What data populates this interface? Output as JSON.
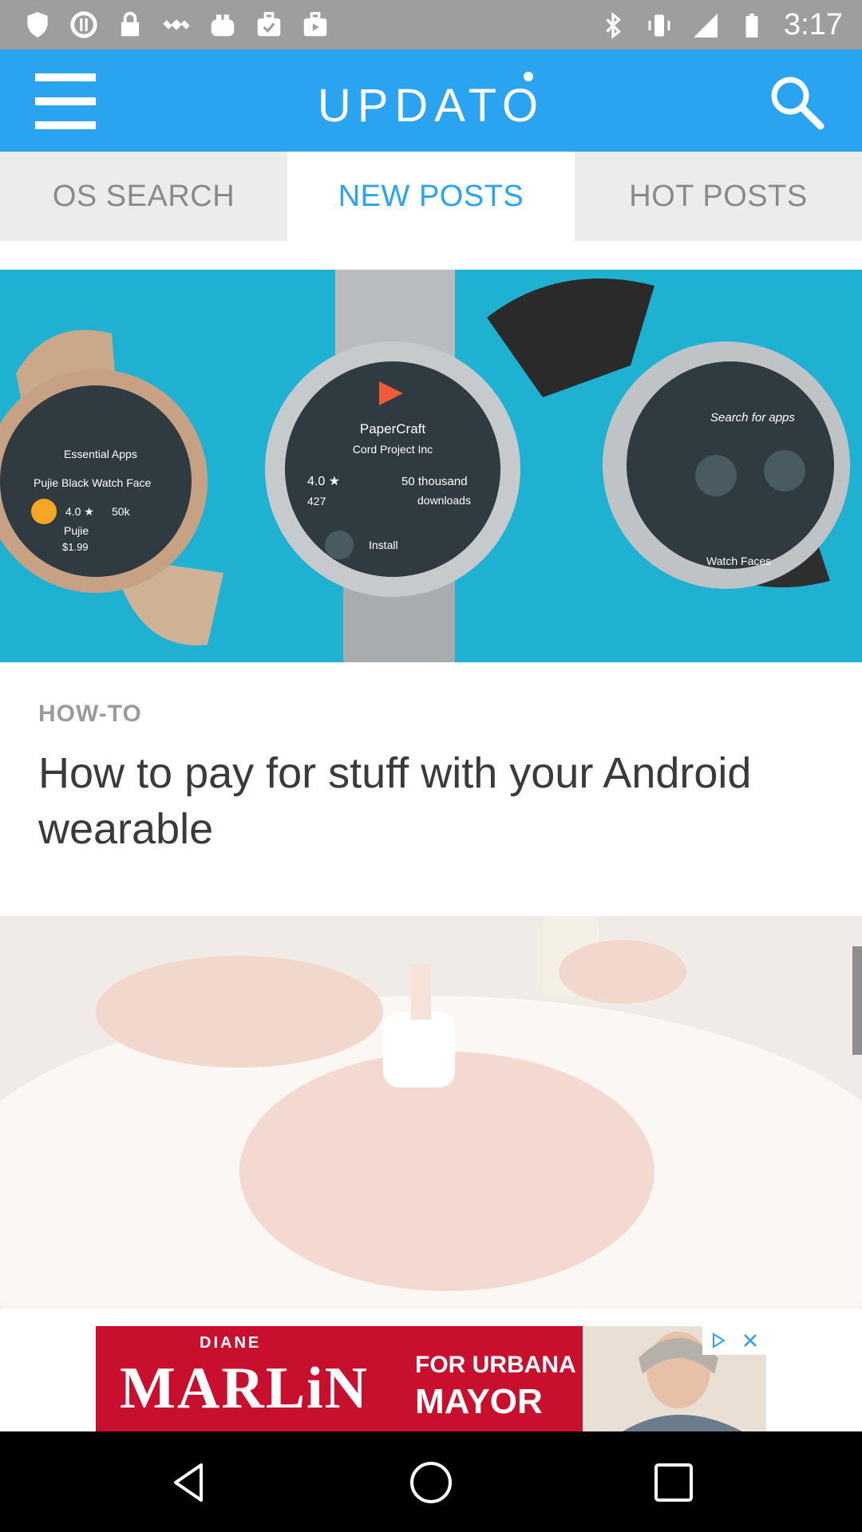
{
  "status_bar": {
    "time": "3:17",
    "left_icons": [
      "shield-icon",
      "sync-icon",
      "lock-icon",
      "satellite-icon",
      "toaster-icon",
      "briefcase-check-icon",
      "briefcase-play-icon"
    ],
    "right_icons": [
      "bluetooth-icon",
      "vibrate-icon",
      "signal-icon",
      "battery-icon"
    ]
  },
  "app_bar": {
    "logo_text": "UPDATO",
    "menu_icon": "hamburger-menu-icon",
    "search_icon": "search-icon",
    "color": "#2aa3f0"
  },
  "tabs": [
    {
      "label": "OS SEARCH",
      "active": false
    },
    {
      "label": "NEW POSTS",
      "active": true
    },
    {
      "label": "HOT POSTS",
      "active": false
    }
  ],
  "articles": [
    {
      "category": "HOW-TO",
      "title": "How to pay for stuff with your Android wearable",
      "image_text": {
        "watch1_line1": "Essential Apps",
        "watch1_line2": "Pujie Black Watch Face",
        "watch1_rating": "4.0 ★",
        "watch1_downloads": "50k",
        "watch1_name": "Pujie",
        "watch1_price": "$1.99",
        "watch2_app": "PaperCraft",
        "watch2_dev": "Cord Project Inc",
        "watch2_rating": "4.0 ★",
        "watch2_reviews": "427",
        "watch2_downloads_num": "50 thousand",
        "watch2_downloads_label": "downloads",
        "watch2_install": "Install",
        "watch3_search": "Search for apps",
        "watch3_faces": "Watch Faces"
      }
    }
  ],
  "ad": {
    "top_text": "DIANE",
    "brand": "MARLiN",
    "tag1": "FOR URBANA",
    "tag2": "MAYOR",
    "controls": [
      "adchoices-icon",
      "close-icon"
    ]
  },
  "nav_bar": {
    "buttons": [
      "back-icon",
      "home-icon",
      "recents-icon"
    ]
  }
}
